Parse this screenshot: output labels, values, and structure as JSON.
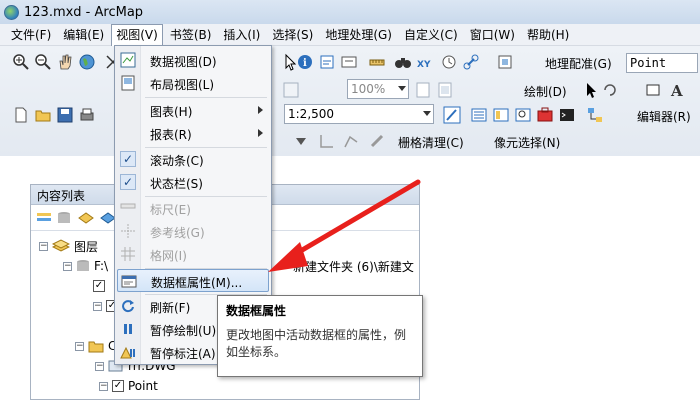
{
  "window": {
    "title": "123.mxd - ArcMap"
  },
  "menubar": [
    "文件(F)",
    "编辑(E)",
    "视图(V)",
    "书签(B)",
    "插入(I)",
    "选择(S)",
    "地理处理(G)",
    "自定义(C)",
    "窗口(W)",
    "帮助(H)"
  ],
  "toolbar": {
    "georef_label": "地理配准(G)",
    "georef_layer": "Point",
    "zoom_value": "100%",
    "scale_value": "1:2,500",
    "draw_label": "绘制(D)",
    "editor_label": "编辑器(R)",
    "raster_cleanup_label": "栅格清理(C)",
    "pixel_select_label": "像元选择(N)"
  },
  "view_menu": {
    "items": [
      {
        "label": "数据视图(D)",
        "icon": "data-view-icon"
      },
      {
        "label": "布局视图(L)",
        "icon": "layout-view-icon"
      },
      {
        "label": "图表(H)",
        "has_submenu": true
      },
      {
        "label": "报表(R)",
        "has_submenu": true
      },
      {
        "label": "滚动条(C)",
        "checked": true
      },
      {
        "label": "状态栏(S)",
        "checked": true
      },
      {
        "label": "标尺(E)",
        "disabled": true
      },
      {
        "label": "参考线(G)",
        "disabled": true
      },
      {
        "label": "格网(I)",
        "disabled": true
      },
      {
        "label": "数据框属性(M)...",
        "highlighted": true,
        "icon": "properties-icon"
      },
      {
        "label": "刷新(F)",
        "icon": "refresh-icon"
      },
      {
        "label": "暂停绘制(U)",
        "icon": "pause-icon"
      },
      {
        "label": "暂停标注(A)",
        "icon": "pause-label-icon"
      }
    ]
  },
  "tooltip": {
    "title": "数据框属性",
    "body": "更改地图中活动数据框的属性，例如坐标系。"
  },
  "toc": {
    "title": "内容列表",
    "root": "图层",
    "path1": "F:\\",
    "path1_tail": "新建文件夹 (6)\\新建文",
    "path2": "C:\\",
    "dwg": "rrr.DWG",
    "point": "Point"
  },
  "colors": {
    "arrow": "#e8201c",
    "highlight": "#d4e5f8",
    "titlebar": "#c9d9ec"
  }
}
